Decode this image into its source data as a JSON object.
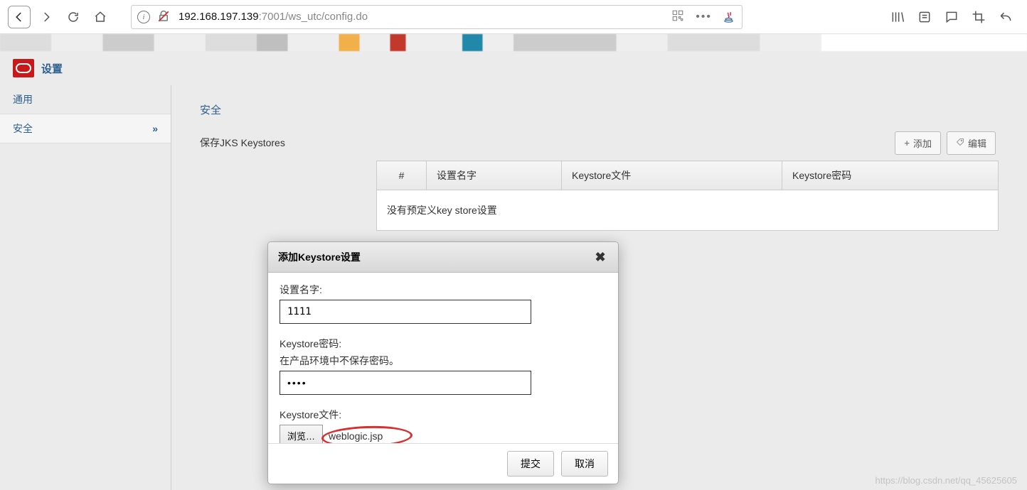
{
  "browser": {
    "url_host": "192.168.197.139",
    "url_rest": ":7001/ws_utc/config.do"
  },
  "app": {
    "title": "设置"
  },
  "sidebar": {
    "items": [
      {
        "label": "通用"
      },
      {
        "label": "安全"
      }
    ]
  },
  "content": {
    "section_title": "安全",
    "row_label": "保存JKS Keystores",
    "buttons": {
      "add": "添加",
      "edit": "编辑"
    },
    "table": {
      "cols": {
        "num": "#",
        "name": "设置名字",
        "file": "Keystore文件",
        "pwd": "Keystore密码"
      },
      "empty": "没有预定义key store设置"
    }
  },
  "dialog": {
    "title": "添加Keystore设置",
    "name_label": "设置名字:",
    "name_value": "1111",
    "pwd_label": "Keystore密码:",
    "pwd_hint": "在产品环境中不保存密码。",
    "pwd_value": "••••",
    "file_label": "Keystore文件:",
    "browse": "浏览…",
    "file_name": "weblogic.jsp",
    "submit": "提交",
    "cancel": "取消"
  },
  "watermark": "https://blog.csdn.net/qq_45625605"
}
